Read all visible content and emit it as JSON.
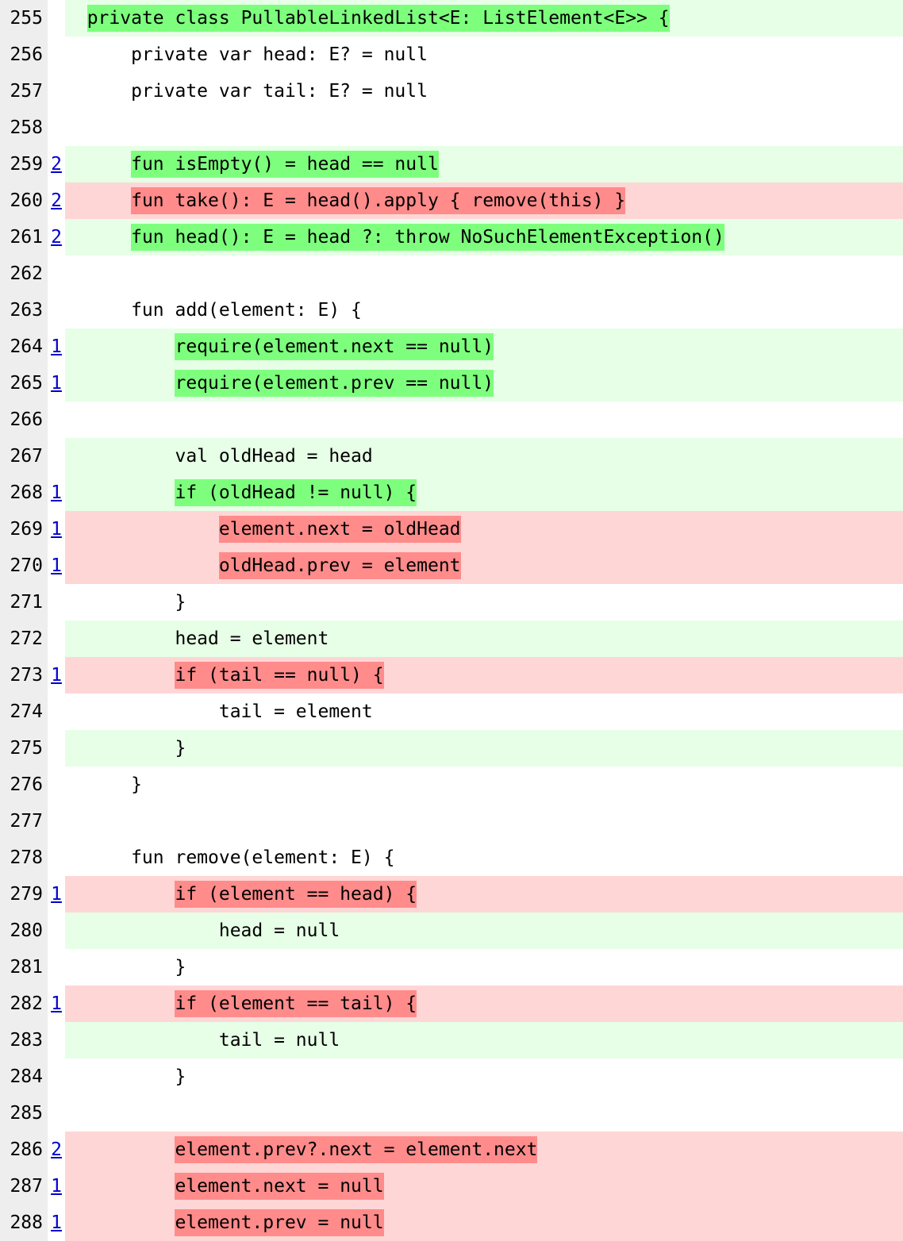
{
  "lines": [
    {
      "num": "255",
      "count": "",
      "rowBg": "green",
      "segs": [
        {
          "text": "  ",
          "hl": ""
        },
        {
          "text": "private class PullableLinkedList<E: ListElement<E>> {",
          "hl": "green"
        }
      ]
    },
    {
      "num": "256",
      "count": "",
      "rowBg": "none",
      "segs": [
        {
          "text": "      private var head: E? = null",
          "hl": ""
        }
      ]
    },
    {
      "num": "257",
      "count": "",
      "rowBg": "none",
      "segs": [
        {
          "text": "      private var tail: E? = null",
          "hl": ""
        }
      ]
    },
    {
      "num": "258",
      "count": "",
      "rowBg": "none",
      "segs": [
        {
          "text": "",
          "hl": ""
        }
      ]
    },
    {
      "num": "259",
      "count": "2",
      "rowBg": "green",
      "segs": [
        {
          "text": "      ",
          "hl": ""
        },
        {
          "text": "fun isEmpty() = head == null",
          "hl": "green"
        }
      ]
    },
    {
      "num": "260",
      "count": "2",
      "rowBg": "red",
      "segs": [
        {
          "text": "      ",
          "hl": ""
        },
        {
          "text": "fun take(): E = head().apply { remove(this) }",
          "hl": "red"
        }
      ]
    },
    {
      "num": "261",
      "count": "2",
      "rowBg": "green",
      "segs": [
        {
          "text": "      ",
          "hl": ""
        },
        {
          "text": "fun head(): E = head ?: throw NoSuchElementException()",
          "hl": "green"
        }
      ]
    },
    {
      "num": "262",
      "count": "",
      "rowBg": "none",
      "segs": [
        {
          "text": "",
          "hl": ""
        }
      ]
    },
    {
      "num": "263",
      "count": "",
      "rowBg": "none",
      "segs": [
        {
          "text": "      fun add(element: E) {",
          "hl": ""
        }
      ]
    },
    {
      "num": "264",
      "count": "1",
      "rowBg": "green",
      "segs": [
        {
          "text": "          ",
          "hl": ""
        },
        {
          "text": "require(element.next == null)",
          "hl": "green"
        }
      ]
    },
    {
      "num": "265",
      "count": "1",
      "rowBg": "green",
      "segs": [
        {
          "text": "          ",
          "hl": ""
        },
        {
          "text": "require(element.prev == null)",
          "hl": "green"
        }
      ]
    },
    {
      "num": "266",
      "count": "",
      "rowBg": "none",
      "segs": [
        {
          "text": "",
          "hl": ""
        }
      ]
    },
    {
      "num": "267",
      "count": "",
      "rowBg": "light",
      "segs": [
        {
          "text": "          val oldHead = head",
          "hl": ""
        }
      ]
    },
    {
      "num": "268",
      "count": "1",
      "rowBg": "green",
      "segs": [
        {
          "text": "          ",
          "hl": ""
        },
        {
          "text": "if (oldHead != null) {",
          "hl": "green"
        }
      ]
    },
    {
      "num": "269",
      "count": "1",
      "rowBg": "red",
      "segs": [
        {
          "text": "              ",
          "hl": ""
        },
        {
          "text": "element.next = oldHead",
          "hl": "red"
        }
      ]
    },
    {
      "num": "270",
      "count": "1",
      "rowBg": "red",
      "segs": [
        {
          "text": "              ",
          "hl": ""
        },
        {
          "text": "oldHead.prev = element",
          "hl": "red"
        }
      ]
    },
    {
      "num": "271",
      "count": "",
      "rowBg": "none",
      "segs": [
        {
          "text": "          }",
          "hl": ""
        }
      ]
    },
    {
      "num": "272",
      "count": "",
      "rowBg": "light",
      "segs": [
        {
          "text": "          head = element",
          "hl": ""
        }
      ]
    },
    {
      "num": "273",
      "count": "1",
      "rowBg": "red",
      "segs": [
        {
          "text": "          ",
          "hl": ""
        },
        {
          "text": "if (tail == null) {",
          "hl": "red"
        }
      ]
    },
    {
      "num": "274",
      "count": "",
      "rowBg": "none",
      "segs": [
        {
          "text": "              tail = element",
          "hl": ""
        }
      ]
    },
    {
      "num": "275",
      "count": "",
      "rowBg": "light",
      "segs": [
        {
          "text": "          }",
          "hl": ""
        }
      ]
    },
    {
      "num": "276",
      "count": "",
      "rowBg": "none",
      "segs": [
        {
          "text": "      }",
          "hl": ""
        }
      ]
    },
    {
      "num": "277",
      "count": "",
      "rowBg": "none",
      "segs": [
        {
          "text": "",
          "hl": ""
        }
      ]
    },
    {
      "num": "278",
      "count": "",
      "rowBg": "none",
      "segs": [
        {
          "text": "      fun remove(element: E) {",
          "hl": ""
        }
      ]
    },
    {
      "num": "279",
      "count": "1",
      "rowBg": "red",
      "segs": [
        {
          "text": "          ",
          "hl": ""
        },
        {
          "text": "if (element == head) {",
          "hl": "red"
        }
      ]
    },
    {
      "num": "280",
      "count": "",
      "rowBg": "light",
      "segs": [
        {
          "text": "              head = null",
          "hl": ""
        }
      ]
    },
    {
      "num": "281",
      "count": "",
      "rowBg": "none",
      "segs": [
        {
          "text": "          }",
          "hl": ""
        }
      ]
    },
    {
      "num": "282",
      "count": "1",
      "rowBg": "red",
      "segs": [
        {
          "text": "          ",
          "hl": ""
        },
        {
          "text": "if (element == tail) {",
          "hl": "red"
        }
      ]
    },
    {
      "num": "283",
      "count": "",
      "rowBg": "light",
      "segs": [
        {
          "text": "              tail = null",
          "hl": ""
        }
      ]
    },
    {
      "num": "284",
      "count": "",
      "rowBg": "none",
      "segs": [
        {
          "text": "          }",
          "hl": ""
        }
      ]
    },
    {
      "num": "285",
      "count": "",
      "rowBg": "none",
      "segs": [
        {
          "text": "",
          "hl": ""
        }
      ]
    },
    {
      "num": "286",
      "count": "2",
      "rowBg": "red",
      "segs": [
        {
          "text": "          ",
          "hl": ""
        },
        {
          "text": "element.prev?.next = element.next",
          "hl": "red"
        }
      ]
    },
    {
      "num": "287",
      "count": "1",
      "rowBg": "red",
      "segs": [
        {
          "text": "          ",
          "hl": ""
        },
        {
          "text": "element.next = null",
          "hl": "red"
        }
      ]
    },
    {
      "num": "288",
      "count": "1",
      "rowBg": "red",
      "segs": [
        {
          "text": "          ",
          "hl": ""
        },
        {
          "text": "element.prev = null",
          "hl": "red"
        }
      ]
    }
  ]
}
